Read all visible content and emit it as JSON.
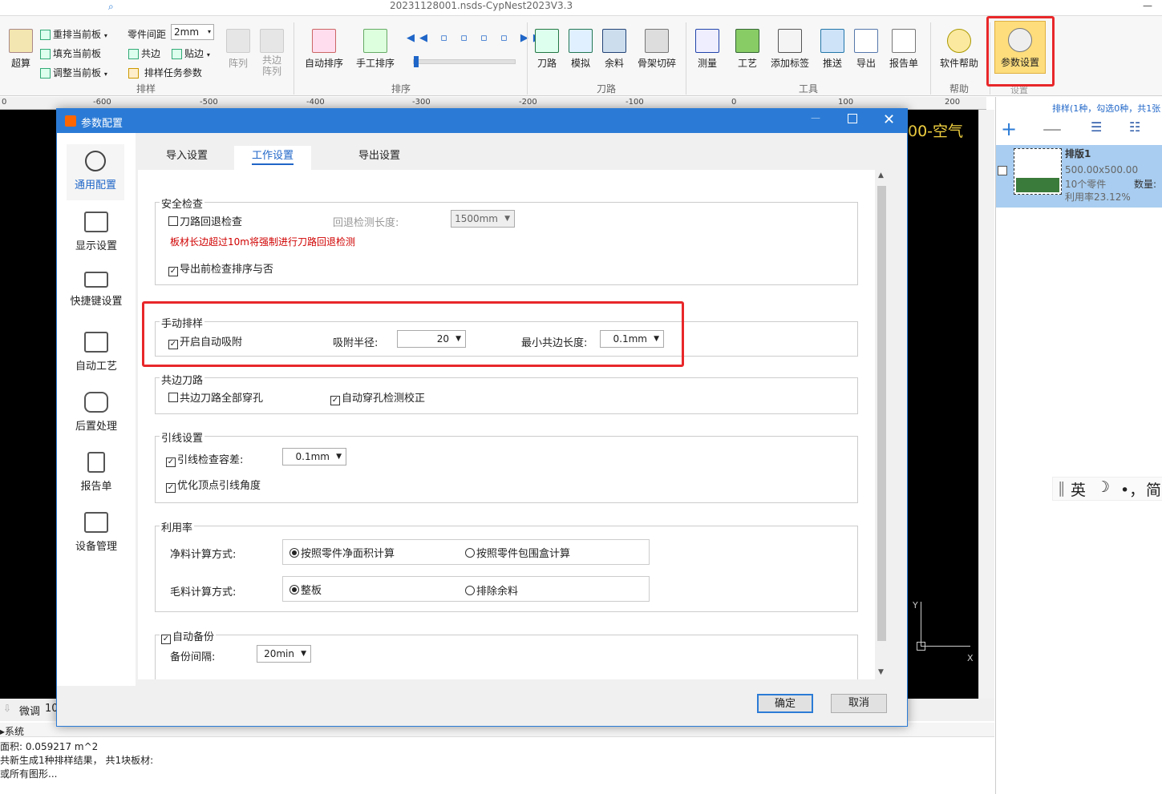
{
  "app": {
    "title": "20231128001.nsds-CypNest2023V3.3"
  },
  "ribbon": {
    "chao_suan": "超算",
    "reflow_current": "重排当前板",
    "fill_current": "填充当前板",
    "adjust_current": "调整当前板",
    "part_gap_label": "零件间距",
    "part_gap_value": "2mm",
    "common_edge": "共边",
    "stick_edge": "贴边",
    "nest_task_params": "排样任务参数",
    "array": "阵列",
    "common_array": "共边阵列",
    "group_nest": "排样",
    "auto_sort": "自动排序",
    "manual_sort": "手工排序",
    "group_sort": "排序",
    "knife_path": "刀路",
    "simulate": "模拟",
    "remnant": "余料",
    "skeleton_cut": "骨架切碎",
    "group_path": "刀路",
    "measure": "测量",
    "process": "工艺",
    "add_label": "添加标签",
    "push": "推送",
    "export": "导出",
    "report": "报告单",
    "group_tools": "工具",
    "software_help": "软件帮助",
    "group_help": "帮助",
    "param_settings": "参数设置",
    "group_settings": "设置"
  },
  "ruler": [
    "0",
    "-600",
    "-500",
    "-400",
    "-300",
    "-200",
    "-100",
    "0",
    "100",
    "200"
  ],
  "canvas": {
    "overlay_text": "00-空气",
    "axis_y": "Y",
    "axis_x": "X"
  },
  "right_panel": {
    "summary": "排样(1种，勾选0种，共1张",
    "sheet_name": "排版1",
    "sheet_size": "500.00x500.00",
    "parts": "10个零件",
    "quantity_label": "数量:",
    "utilization": "利用率23.12%",
    "ime": [
      "英",
      "☽",
      "•，",
      "简"
    ]
  },
  "bottom": {
    "fine_tune": "微调",
    "fine_value": "10",
    "tab_system": "系统",
    "log": [
      "面积: 0.059217 m^2",
      "共新生成1种排样结果， 共1块板材:",
      "或所有图形..."
    ]
  },
  "dialog": {
    "title": "参数配置",
    "sidebar": [
      "通用配置",
      "显示设置",
      "快捷键设置",
      "自动工艺",
      "后置处理",
      "报告单",
      "设备管理"
    ],
    "tabs": [
      "导入设置",
      "工作设置",
      "导出设置"
    ],
    "safety": {
      "legend": "安全检查",
      "retract_check": "刀路回退检查",
      "retract_len_label": "回退检测长度:",
      "retract_len": "1500mm",
      "warning": "板材长边超过10m将强制进行刀路回退检测",
      "check_before_export": "导出前检查排序与否"
    },
    "manual": {
      "legend": "手动排样",
      "auto_snap": "开启自动吸附",
      "snap_radius_label": "吸附半径:",
      "snap_radius": "20",
      "min_common_label": "最小共边长度:",
      "min_common": "0.1mm"
    },
    "common": {
      "legend": "共边刀路",
      "all_pierce": "共边刀路全部穿孔",
      "auto_pierce_fix": "自动穿孔检测校正"
    },
    "lead": {
      "legend": "引线设置",
      "tolerance_label": "引线检查容差:",
      "tolerance": "0.1mm",
      "optimize": "优化顶点引线角度"
    },
    "util": {
      "legend": "利用率",
      "net_label": "净料计算方式:",
      "net_opt1": "按照零件净面积计算",
      "net_opt2": "按照零件包围盒计算",
      "gross_label": "毛料计算方式:",
      "gross_opt1": "整板",
      "gross_opt2": "排除余料"
    },
    "backup": {
      "legend": "自动备份",
      "interval_label": "备份间隔:",
      "interval": "20min"
    },
    "ok": "确定",
    "cancel": "取消"
  },
  "colors": {
    "accent": "#2b7bd6",
    "highlight": "#e8272a",
    "warning": "#d00000"
  }
}
